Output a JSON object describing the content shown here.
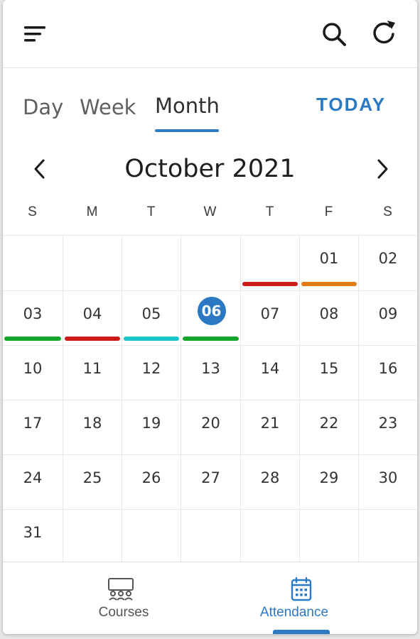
{
  "header": {
    "icons": {
      "menu": "filter-menu-icon",
      "search": "search-icon",
      "refresh": "refresh-icon"
    }
  },
  "view_tabs": {
    "day": "Day",
    "week": "Week",
    "month": "Month",
    "active": "Month",
    "today": "TODAY"
  },
  "month_nav": {
    "title": "October 2021",
    "prev_icon": "chevron-left-icon",
    "next_icon": "chevron-right-icon"
  },
  "weekdays": [
    "S",
    "M",
    "T",
    "W",
    "T",
    "F",
    "S"
  ],
  "calendar": {
    "selected_day": "06",
    "weeks": [
      [
        "",
        "",
        "",
        "",
        "",
        "01",
        "02"
      ],
      [
        "03",
        "04",
        "05",
        "06",
        "07",
        "08",
        "09"
      ],
      [
        "10",
        "11",
        "12",
        "13",
        "14",
        "15",
        "16"
      ],
      [
        "17",
        "18",
        "19",
        "20",
        "21",
        "22",
        "23"
      ],
      [
        "24",
        "25",
        "26",
        "27",
        "28",
        "29",
        "30"
      ],
      [
        "31",
        "",
        "",
        "",
        "",
        "",
        ""
      ]
    ],
    "indicators": [
      {
        "week": 0,
        "day": 4,
        "color": "#cc1a1a"
      },
      {
        "week": 0,
        "day": 5,
        "color": "#e07b12"
      },
      {
        "week": 1,
        "day": 0,
        "color": "#12a52a"
      },
      {
        "week": 1,
        "day": 1,
        "color": "#cc1a1a"
      },
      {
        "week": 1,
        "day": 2,
        "color": "#1cc6c8"
      },
      {
        "week": 1,
        "day": 3,
        "color": "#12a52a"
      }
    ]
  },
  "bottom_nav": {
    "courses": {
      "label": "Courses",
      "icon": "courses-icon"
    },
    "attendance": {
      "label": "Attendance",
      "icon": "calendar-icon",
      "active": true
    }
  },
  "colors": {
    "accent": "#2b79c2",
    "red": "#cc1a1a",
    "orange": "#e07b12",
    "green": "#12a52a",
    "teal": "#1cc6c8"
  }
}
